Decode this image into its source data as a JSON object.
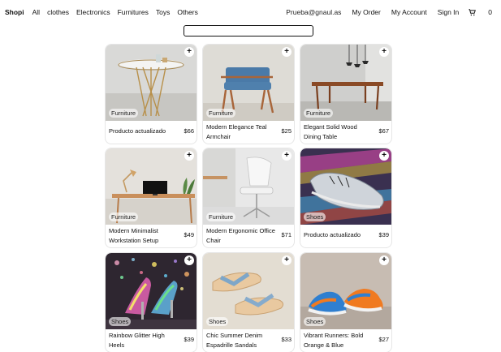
{
  "nav": {
    "brand": "Shopi",
    "categories": [
      "All",
      "clothes",
      "Electronics",
      "Furnitures",
      "Toys",
      "Others"
    ],
    "email": "Prueba@gnaul.as",
    "my_order": "My Order",
    "my_account": "My Account",
    "sign_in": "Sign In",
    "cart_count": "0"
  },
  "search": {
    "value": "",
    "placeholder": ""
  },
  "products": [
    {
      "category": "Furniture",
      "name": "Producto actualizado",
      "price": "$66"
    },
    {
      "category": "Furniture",
      "name": "Modern Elegance Teal Armchair",
      "price": "$25"
    },
    {
      "category": "Furniture",
      "name": "Elegant Solid Wood Dining Table",
      "price": "$67"
    },
    {
      "category": "Furniture",
      "name": "Modern Minimalist Workstation Setup",
      "price": "$49"
    },
    {
      "category": "Furniture",
      "name": "Modern Ergonomic Office Chair",
      "price": "$71"
    },
    {
      "category": "Shoes",
      "name": "Producto actualizado",
      "price": "$39"
    },
    {
      "category": "Shoes",
      "name": "Rainbow Glitter High Heels",
      "price": "$39"
    },
    {
      "category": "Shoes",
      "name": "Chic Summer Denim Espadrille Sandals",
      "price": "$33"
    },
    {
      "category": "Shoes",
      "name": "Vibrant Runners: Bold Orange & Blue",
      "price": "$27"
    }
  ],
  "icons": {
    "cart": "cart-icon",
    "add": "plus-icon"
  },
  "colors": {
    "text": "#111111",
    "border": "#111111"
  }
}
